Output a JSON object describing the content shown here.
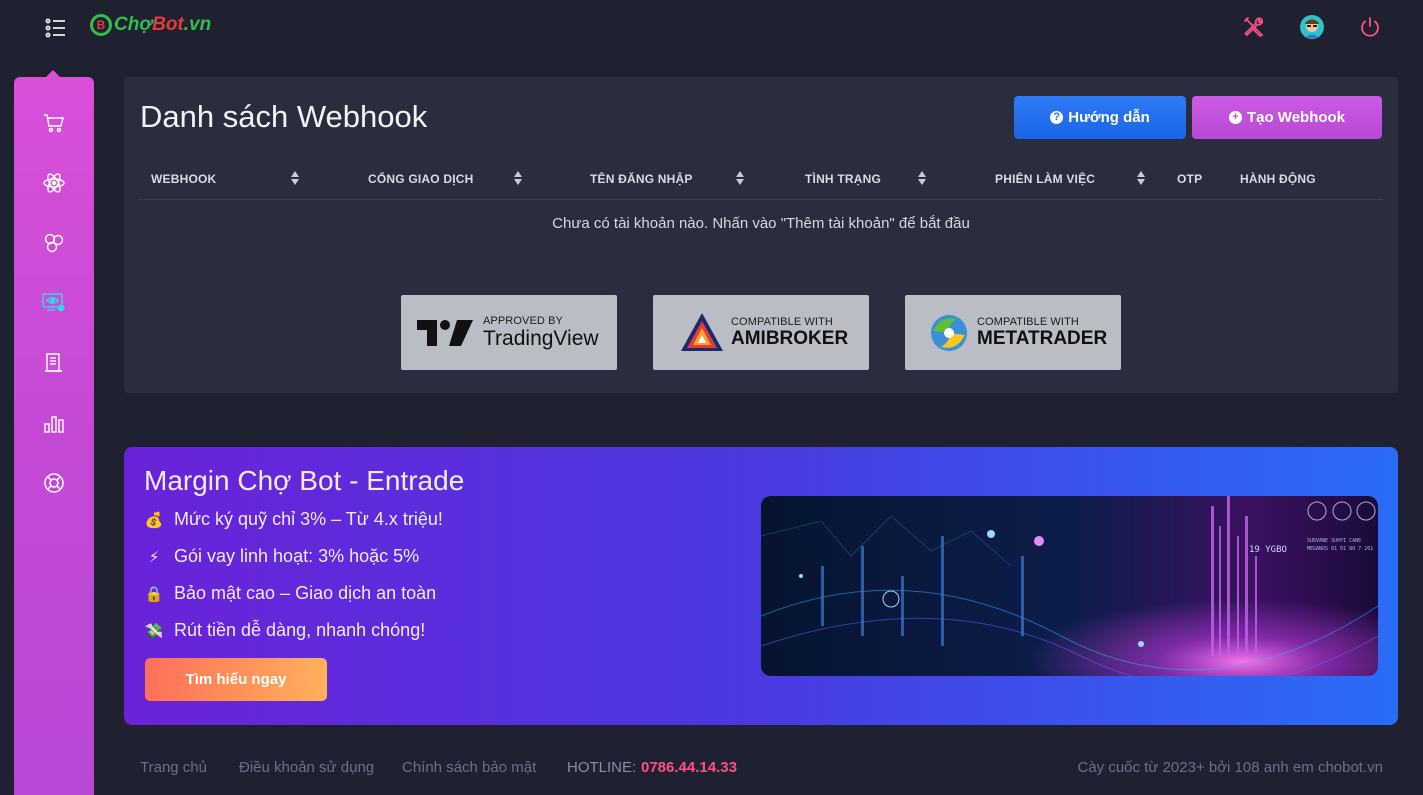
{
  "header": {
    "logo_badge": "B",
    "logo_cho": "Chợ",
    "logo_bot": "Bot",
    "logo_vn": ".vn"
  },
  "card": {
    "title": "Danh sách Webhook",
    "guide_label": "Hướng dẫn",
    "guide_icon": "?",
    "create_label": "Tạo Webhook",
    "create_icon": "+",
    "columns": [
      "WEBHOOK",
      "CỔNG GIAO DỊCH",
      "TÊN ĐĂNG NHẬP",
      "TÌNH TRẠNG",
      "PHIÊN LÀM VIỆC",
      "OTP",
      "HÀNH ĐỘNG"
    ],
    "empty_message": "Chưa có tài khoản nào. Nhấn vào \"Thêm tài khoản\" để bắt đầu"
  },
  "badges": {
    "tradingview": {
      "small": "APPROVED BY",
      "big": "TradingView"
    },
    "amibroker": {
      "small": "COMPATIBLE WITH",
      "big": "AMIBROKER"
    },
    "metatrader": {
      "small": "COMPATIBLE WITH",
      "big": "METATRADER"
    }
  },
  "promo": {
    "title": "Margin Chợ Bot - Entrade",
    "lines": [
      {
        "icon": "💰",
        "text": "Mức ký quỹ chỉ 3% – Từ 4.x triệu!"
      },
      {
        "icon": "⚡",
        "text": "Gói vay linh hoạt: 3% hoặc 5%"
      },
      {
        "icon": "🔒",
        "text": "Bảo mật cao – Giao dịch an toàn"
      },
      {
        "icon": "💸",
        "text": "Rút tiền dễ dàng, nhanh chóng!"
      }
    ],
    "cta": "Tìm hiểu ngay",
    "image_text_1": "19 YGBO",
    "image_text_2": "SUDVANE SUPPI CANE",
    "image_text_3": "MEGANOS 01 01 80 7 201"
  },
  "footer": {
    "home": "Trang chủ",
    "terms": "Điều khoản sử dụng",
    "privacy": "Chính sách bảo mật",
    "hotline_label": "HOTLINE:",
    "hotline_number": "0786.44.14.33",
    "credit": "Cày cuốc từ 2023+ bởi 108 anh em chobot.vn"
  },
  "colors": {
    "accent_pink": "#d94fd8",
    "accent_blue": "#1f6ff0",
    "hotline": "#ff4f8a"
  }
}
